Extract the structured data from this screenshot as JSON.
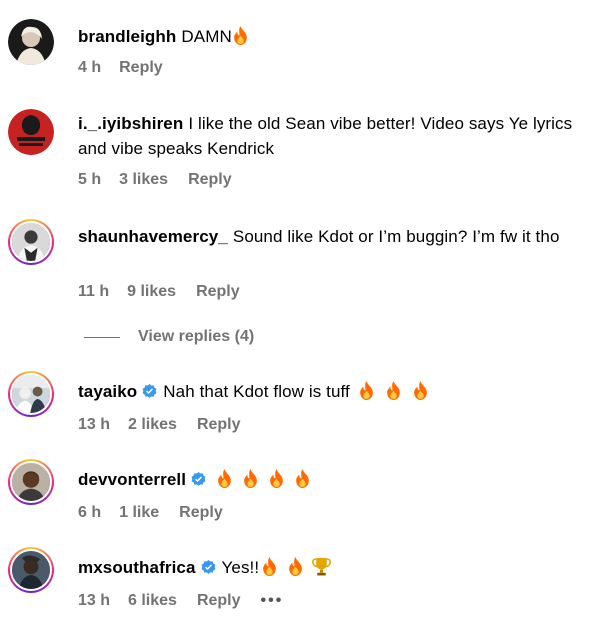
{
  "comments": [
    {
      "username": "brandleighh",
      "text": "DAMN",
      "emoji": "🔥",
      "time": "4 h",
      "likes": "",
      "reply": "Reply"
    },
    {
      "username": "i._.iyibshiren",
      "text": "I like the old Sean vibe better! Video says Ye lyrics and vibe speaks Kendrick",
      "time": "5 h",
      "likes": "3 likes",
      "reply": "Reply"
    },
    {
      "username": "shaunhavemercy_",
      "text": "Sound like Kdot or I’m buggin? I’m fw it tho",
      "time": "11 h",
      "likes": "9 likes",
      "reply": "Reply"
    },
    {
      "username": "tayaiko",
      "text": "Nah that Kdot flow is tuff",
      "emoji": "🔥 🔥 🔥",
      "time": "13 h",
      "likes": "2 likes",
      "reply": "Reply",
      "verified": true
    },
    {
      "username": "devvonterrell",
      "text": "",
      "emoji": "🔥🔥🔥🔥",
      "time": "6 h",
      "likes": "1 like",
      "reply": "Reply",
      "verified": true
    },
    {
      "username": "mxsouthafrica",
      "text": "Yes!!",
      "emoji": "🔥 🔥 🏆",
      "time": "13 h",
      "likes": "6 likes",
      "reply": "Reply",
      "verified": true,
      "more": "•••"
    }
  ],
  "view_replies": "View replies (4)",
  "colors": {
    "meta": "#737373",
    "verified": "#3897f0",
    "fire": "#ff6a00"
  }
}
